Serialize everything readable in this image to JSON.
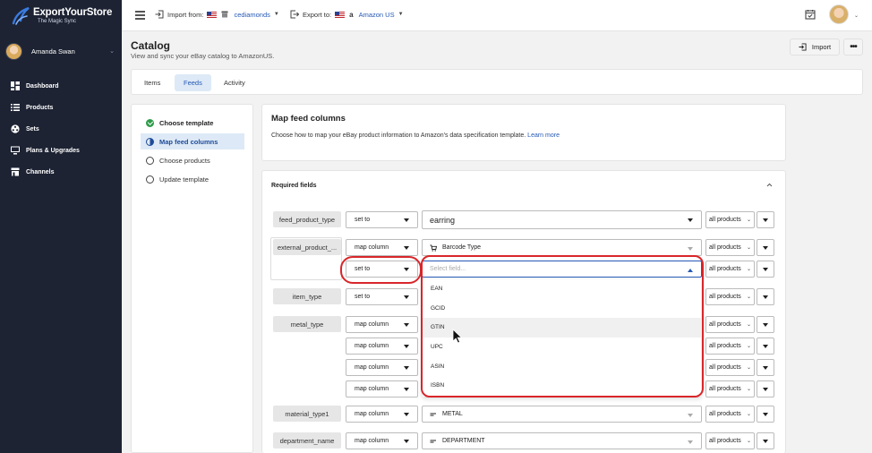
{
  "app": {
    "logo_title": "ExportYourStore",
    "logo_subtitle": "The Magic Sync",
    "user_name": "Amanda Swan"
  },
  "sidebar": {
    "items": [
      {
        "label": "Dashboard",
        "icon": "dashboard-icon"
      },
      {
        "label": "Products",
        "icon": "list-icon"
      },
      {
        "label": "Sets",
        "icon": "sets-icon"
      },
      {
        "label": "Plans & Upgrades",
        "icon": "monitor-icon"
      },
      {
        "label": "Channels",
        "icon": "store-icon"
      }
    ]
  },
  "topbar": {
    "import_label": "Import from:",
    "import_store": "cediamonds",
    "export_label": "Export to:",
    "export_store": "Amazon US"
  },
  "page": {
    "title": "Catalog",
    "subtitle": "View and sync your eBay catalog to AmazonUS.",
    "import_button": "Import",
    "more_button": "•••"
  },
  "tabs": [
    {
      "label": "Items",
      "active": false
    },
    {
      "label": "Feeds",
      "active": true
    },
    {
      "label": "Activity",
      "active": false
    }
  ],
  "steps": [
    {
      "label": "Choose template",
      "state": "done"
    },
    {
      "label": "Map feed columns",
      "state": "active"
    },
    {
      "label": "Choose products",
      "state": "pending"
    },
    {
      "label": "Update template",
      "state": "pending"
    }
  ],
  "map_panel": {
    "title": "Map feed columns",
    "description": "Choose how to map your eBay product information to Amazon's data specification template.",
    "learn_more": "Learn more"
  },
  "required": {
    "title": "Required fields",
    "labels": {
      "feed_product_type": "feed_product_type",
      "external_product": "external_product_...",
      "item_type": "item_type",
      "metal_type": "metal_type",
      "material_type1": "material_type1",
      "department_name": "department_name"
    },
    "modes": {
      "set_to": "set to",
      "map_column": "map column"
    },
    "values": {
      "feed_product_type": "earring",
      "barcode_type": "Barcode Type",
      "select_placeholder": "Select field...",
      "metal": "METAL",
      "department": "DEPARTMENT"
    },
    "scope": "all products",
    "dropdown_options": [
      "EAN",
      "GCID",
      "GTIN",
      "UPC",
      "ASIN",
      "ISBN"
    ],
    "highlight_color": "#d8262a"
  }
}
